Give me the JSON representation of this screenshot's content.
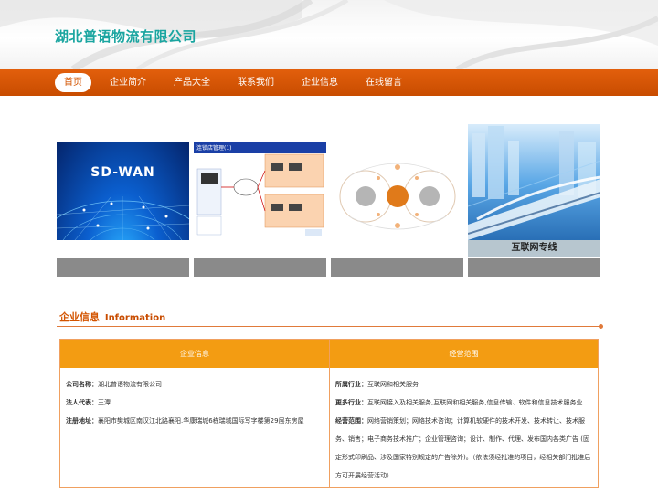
{
  "site": {
    "title": "湖北普语物流有限公司"
  },
  "nav": {
    "items": [
      {
        "label": "首页",
        "active": true
      },
      {
        "label": "企业简介"
      },
      {
        "label": "产品大全"
      },
      {
        "label": "联系我们"
      },
      {
        "label": "企业信息"
      },
      {
        "label": "在线留言"
      }
    ]
  },
  "gallery": {
    "sdwan_text": "SD-WAN",
    "network_title": "连锁店管理(1)",
    "train_label": "互联网专线"
  },
  "info_section": {
    "title_cn": "企业信息",
    "title_en": "Information",
    "left_header": "企业信息",
    "right_header": "经营范围",
    "company": {
      "label": "公司名称：",
      "value": "湖北普语物流有限公司"
    },
    "legal": {
      "label": "法人代表：",
      "value": "王潭"
    },
    "address": {
      "label": "注册地址：",
      "value": "襄阳市樊城区南汉江北路襄阳.华康瑞城6栋瑞城国际写字楼第29层东房屋"
    },
    "industry": {
      "label": "所属行业：",
      "value": "互联网和相关服务"
    },
    "more_industry": {
      "label": "更多行业：",
      "value": "互联网接入及相关服务,互联网和相关服务,信息传输、软件和信息技术服务业"
    },
    "scope": {
      "label": "经营范围：",
      "line1": "网络营销策划；网络技术咨询；计算机软硬件的技术开发、技术转让、技术服",
      "line2": "务、销售；电子商务技术推广；企业管理咨询；设计、制作、代理、发布国内各类广告 (固",
      "line3": "定形式印刷品、涉及国家特别规定的广告除外)。（依法须经批准的项目，经相关部门批准后",
      "line4": "方可开展经营活动）"
    }
  },
  "colors": {
    "brand": "#1aa5a0",
    "nav": "#d35400",
    "table_header": "#f39c12"
  }
}
